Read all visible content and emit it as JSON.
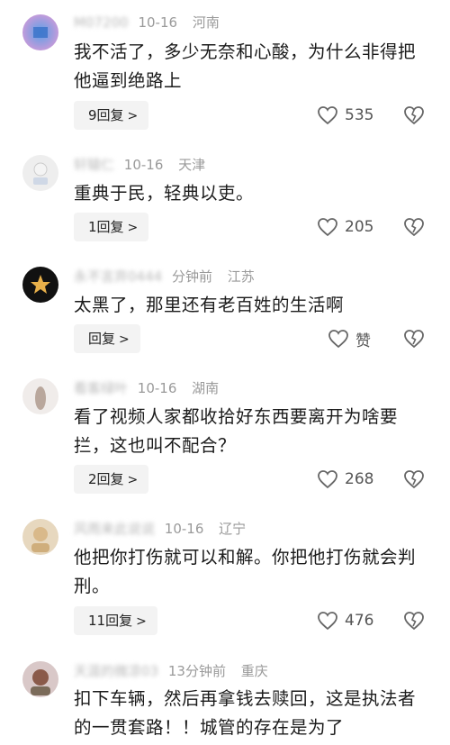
{
  "comments": [
    {
      "name": "M07200",
      "time": "10-16",
      "location": "河南",
      "text": "我不活了，多少无奈和心酸，为什么非得把他逼到绝路上",
      "reply_label": "9回复",
      "likes": "535"
    },
    {
      "name": "轩辕仁",
      "time": "10-16",
      "location": "天津",
      "text": "重典于民，轻典以吏。",
      "reply_label": "1回复",
      "likes": "205"
    },
    {
      "name": "永不言弃0444",
      "time": "分钟前",
      "location": "江苏",
      "text": "太黑了，那里还有老百姓的生活啊",
      "reply_label": "回复",
      "likes": "赞"
    },
    {
      "name": "看客绿叶",
      "time": "10-16",
      "location": "湖南",
      "text": "看了视频人家都收拾好东西要离开为啥要拦，这也叫不配合？",
      "reply_label": "2回复",
      "likes": "268"
    },
    {
      "name": "风雨来此说说",
      "time": "10-16",
      "location": "辽宁",
      "text": "他把你打伤就可以和解。你把他打伤就会判刑。",
      "reply_label": "11回复",
      "likes": "476"
    },
    {
      "name": "天涯的微凉03",
      "time": "13分钟前",
      "location": "重庆",
      "text": "扣下车辆，然后再拿钱去赎回，这是执法者的一贯套路！！城管的存在是为了",
      "reply_label": "",
      "likes": ""
    }
  ]
}
